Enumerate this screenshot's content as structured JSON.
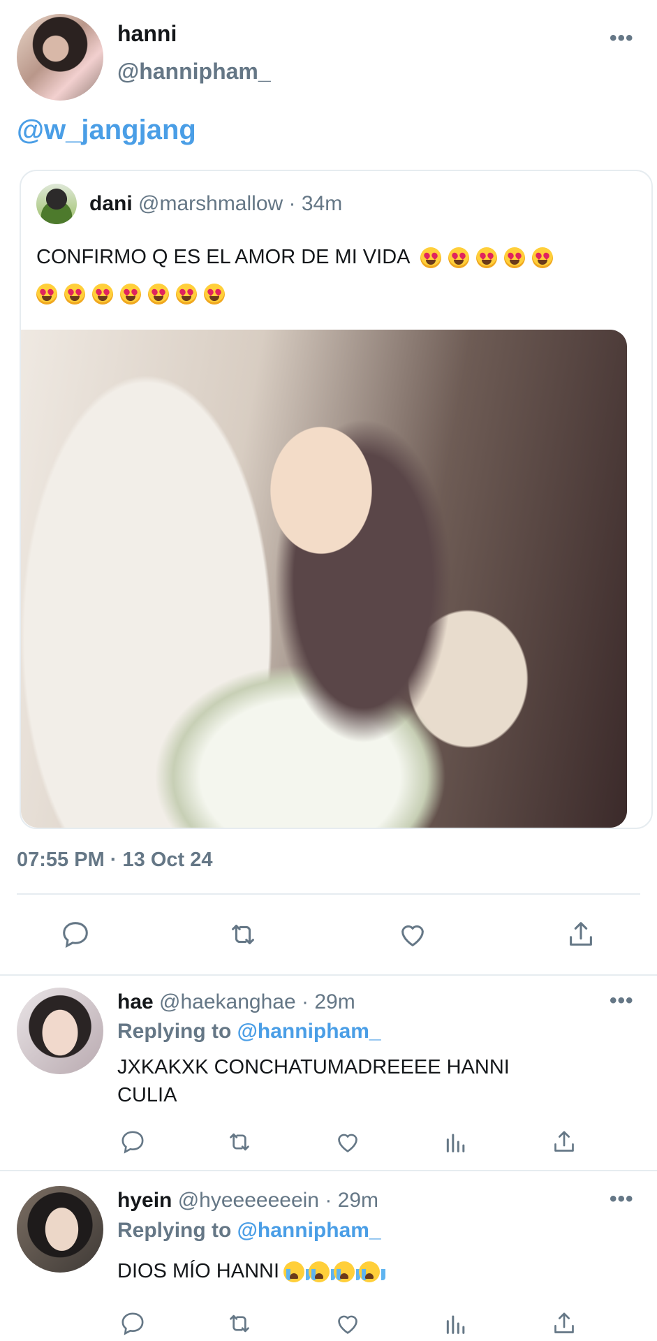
{
  "main_tweet": {
    "author_name": "hanni",
    "author_handle": "@hannipham_",
    "more_label": "•••",
    "text": "@w_jangjang",
    "timestamp": "07:55 PM · 13 Oct 24"
  },
  "quoted_tweet": {
    "author_name": "dani",
    "meta": "@marshmallow · 34m",
    "text": "CONFIRMO Q ES EL AMOR DE MI VIDA",
    "emoji_name": "smiling-face-with-heart-eyes",
    "emoji_count_line1": 5,
    "emoji_count_line2": 7
  },
  "main_actions": [
    "reply-icon",
    "retweet-icon",
    "like-icon",
    "share-icon"
  ],
  "replies": [
    {
      "author_name": "hae",
      "meta": "@haekanghae · 29m",
      "replying_prefix": "Replying to ",
      "replying_to": "@hannipham_",
      "text_line1": "JXKAKXK CONCHATUMADREEEE HANNI",
      "text_line2": "CULIA",
      "more_label": "•••"
    },
    {
      "author_name": "hyein",
      "meta": "@hyeeeeeeein · 29m",
      "replying_prefix": "Replying to ",
      "replying_to": "@hannipham_",
      "text_line1": "DIOS MÍO HANNI",
      "emoji_name": "loudly-crying-face",
      "emoji_count": 4,
      "more_label": "•••"
    }
  ],
  "reply_actions": [
    "reply-icon",
    "retweet-icon",
    "like-icon",
    "analytics-icon",
    "share-icon"
  ],
  "colors": {
    "link_blue": "#4a9ee6",
    "secondary_gray": "#657786",
    "divider": "#e6ecf0"
  }
}
